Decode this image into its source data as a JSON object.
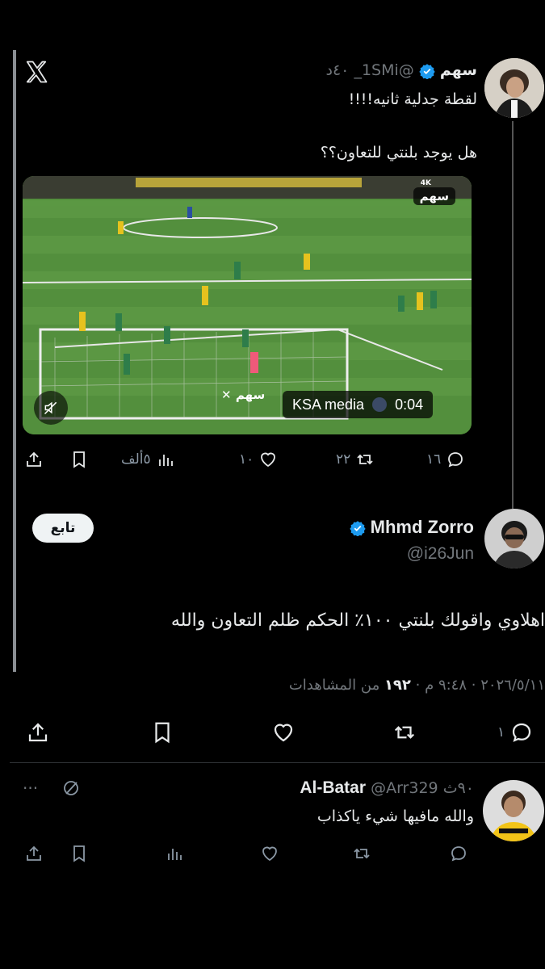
{
  "tweet1": {
    "display_name": "سهم",
    "handle": "@1SMi_",
    "time": "٤٠د",
    "line1": "لقطة جدلية ثانيه!!!!",
    "line2": "هل يوجد بلنتي للتعاون؟؟",
    "video": {
      "watermark": "سهم",
      "quality": "4K",
      "overlay_brand": "KSA media",
      "duration": "0:04",
      "watermark2": "سهم"
    },
    "stats": {
      "replies": "١٦",
      "retweets": "٢٢",
      "likes": "١٠",
      "views": "٥ألف"
    }
  },
  "tweet2": {
    "display_name": "Mhmd Zorro",
    "handle": "@i26Jun",
    "follow_label": "تابع",
    "text": "اهلاوي واقولك بلنتي ١٠٠٪ الحكم ظلم التعاون والله",
    "meta_date": "٢٠٢٦/٥/١١ · ٩:٤٨ م · ",
    "meta_views": "١٩٢",
    "meta_views_label": " من المشاهدات",
    "stats": {
      "replies": "١"
    }
  },
  "reply": {
    "display_name": "Al-Batar",
    "handle": "@Arr329",
    "time": "٩٠ث",
    "text": "والله مافيها شيء ياكذاب",
    "more": "···"
  },
  "colors": {
    "verified": "#1d9bf0",
    "background": "#000000",
    "muted": "#71767b",
    "pitch": "#4e8a3a"
  }
}
